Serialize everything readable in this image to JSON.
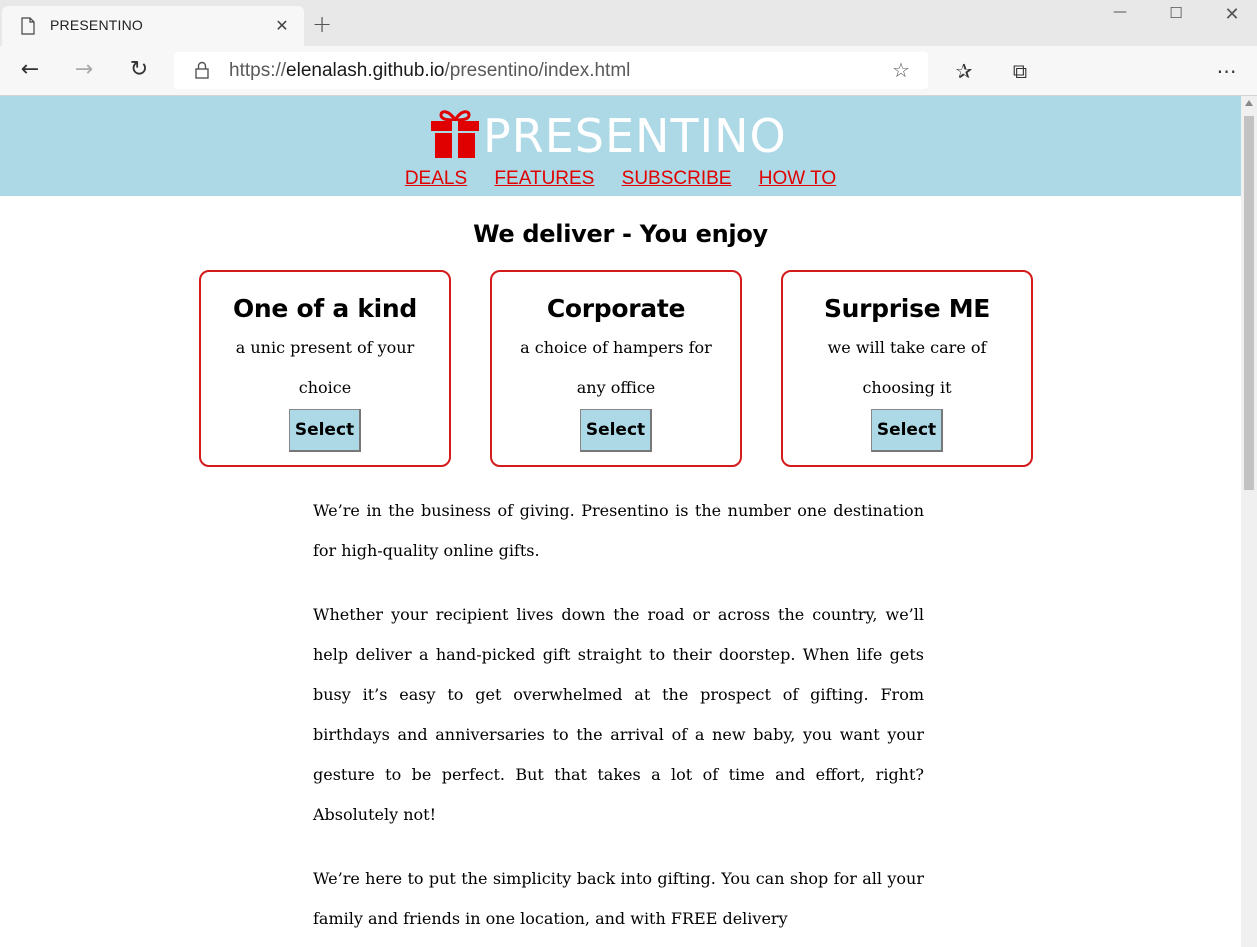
{
  "browser": {
    "tab_title": "PRESENTINO",
    "tab_close": "✕",
    "new_tab": "+",
    "url_prefix": "https://",
    "url_host": "elenalash.github.io",
    "url_path": "/presentino/index.html",
    "icons": [
      "page-icon",
      "close-icon",
      "plus-icon",
      "minimize-icon",
      "maximize-icon",
      "window-close-icon",
      "back-icon",
      "forward-icon",
      "reload-icon",
      "lock-icon",
      "star-icon",
      "favorites-icon",
      "collections-icon",
      "more-icon"
    ]
  },
  "site": {
    "brand": "PRESENTINO",
    "nav": [
      "DEALS",
      "FEATURES",
      "SUBSCRIBE",
      "HOW TO"
    ],
    "tagline": "We deliver - You enjoy",
    "cards": [
      {
        "title": "One of a kind",
        "desc": "a unic present of your choice",
        "button": "Select"
      },
      {
        "title": "Corporate",
        "desc": "a choice of hampers for any office",
        "button": "Select"
      },
      {
        "title": "Surprise ME",
        "desc": "we will take care of choosing it",
        "button": "Select"
      }
    ],
    "paragraphs": [
      "We’re in the business of giving. Presentino is the number one destination for high-quality online gifts.",
      "Whether your recipient lives down the road or across the country, we’ll help deliver a hand-picked gift straight to their doorstep. When life gets busy it’s easy to get overwhelmed at the prospect of gifting. From birthdays and anniversaries to the arrival of a new baby, you want your gesture to be perfect. But that takes a lot of time and effort, right? Absolutely not!",
      "We’re here to put the simplicity back into gifting. You can shop for all your family and friends in one location, and with FREE delivery"
    ]
  },
  "colors": {
    "header_bg": "#add8e6",
    "accent_red": "#e00000",
    "card_border": "#d41a1a",
    "button_bg": "#add8e6"
  }
}
